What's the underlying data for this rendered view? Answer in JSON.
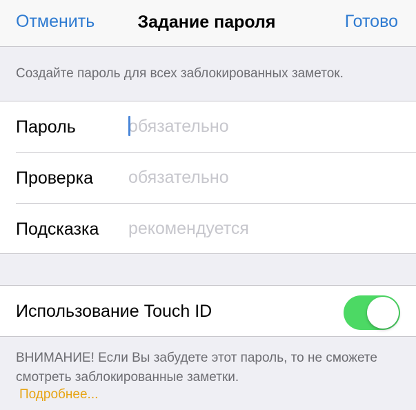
{
  "nav": {
    "cancel_label": "Отменить",
    "title": "Задание пароля",
    "done_label": "Готово"
  },
  "header_text": "Создайте пароль для всех заблокированных заметок.",
  "fields": [
    {
      "label": "Пароль",
      "placeholder": "обязательно",
      "value": ""
    },
    {
      "label": "Проверка",
      "placeholder": "обязательно",
      "value": ""
    },
    {
      "label": "Подсказка",
      "placeholder": "рекомендуется",
      "value": ""
    }
  ],
  "touch_id": {
    "label": "Использование Touch ID",
    "enabled": true
  },
  "footer": {
    "warning": "ВНИМАНИЕ! Если Вы забудете этот пароль, то не сможете смотреть заблокированные заметки.",
    "more_link": "Подробнее..."
  },
  "colors": {
    "accent": "#2f7bd1",
    "switch_on": "#4cd964",
    "link": "#e7a414",
    "background": "#efeff4"
  }
}
